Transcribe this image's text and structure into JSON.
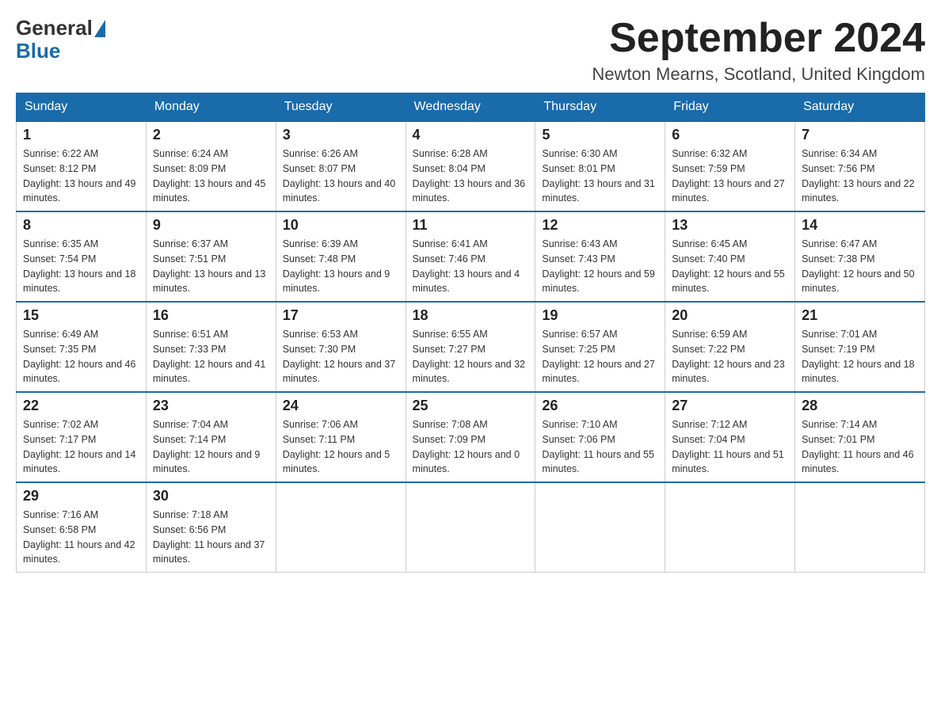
{
  "header": {
    "logo_general": "General",
    "logo_blue": "Blue",
    "month_title": "September 2024",
    "location": "Newton Mearns, Scotland, United Kingdom"
  },
  "weekdays": [
    "Sunday",
    "Monday",
    "Tuesday",
    "Wednesday",
    "Thursday",
    "Friday",
    "Saturday"
  ],
  "weeks": [
    [
      {
        "day": "1",
        "sunrise": "6:22 AM",
        "sunset": "8:12 PM",
        "daylight": "13 hours and 49 minutes."
      },
      {
        "day": "2",
        "sunrise": "6:24 AM",
        "sunset": "8:09 PM",
        "daylight": "13 hours and 45 minutes."
      },
      {
        "day": "3",
        "sunrise": "6:26 AM",
        "sunset": "8:07 PM",
        "daylight": "13 hours and 40 minutes."
      },
      {
        "day": "4",
        "sunrise": "6:28 AM",
        "sunset": "8:04 PM",
        "daylight": "13 hours and 36 minutes."
      },
      {
        "day": "5",
        "sunrise": "6:30 AM",
        "sunset": "8:01 PM",
        "daylight": "13 hours and 31 minutes."
      },
      {
        "day": "6",
        "sunrise": "6:32 AM",
        "sunset": "7:59 PM",
        "daylight": "13 hours and 27 minutes."
      },
      {
        "day": "7",
        "sunrise": "6:34 AM",
        "sunset": "7:56 PM",
        "daylight": "13 hours and 22 minutes."
      }
    ],
    [
      {
        "day": "8",
        "sunrise": "6:35 AM",
        "sunset": "7:54 PM",
        "daylight": "13 hours and 18 minutes."
      },
      {
        "day": "9",
        "sunrise": "6:37 AM",
        "sunset": "7:51 PM",
        "daylight": "13 hours and 13 minutes."
      },
      {
        "day": "10",
        "sunrise": "6:39 AM",
        "sunset": "7:48 PM",
        "daylight": "13 hours and 9 minutes."
      },
      {
        "day": "11",
        "sunrise": "6:41 AM",
        "sunset": "7:46 PM",
        "daylight": "13 hours and 4 minutes."
      },
      {
        "day": "12",
        "sunrise": "6:43 AM",
        "sunset": "7:43 PM",
        "daylight": "12 hours and 59 minutes."
      },
      {
        "day": "13",
        "sunrise": "6:45 AM",
        "sunset": "7:40 PM",
        "daylight": "12 hours and 55 minutes."
      },
      {
        "day": "14",
        "sunrise": "6:47 AM",
        "sunset": "7:38 PM",
        "daylight": "12 hours and 50 minutes."
      }
    ],
    [
      {
        "day": "15",
        "sunrise": "6:49 AM",
        "sunset": "7:35 PM",
        "daylight": "12 hours and 46 minutes."
      },
      {
        "day": "16",
        "sunrise": "6:51 AM",
        "sunset": "7:33 PM",
        "daylight": "12 hours and 41 minutes."
      },
      {
        "day": "17",
        "sunrise": "6:53 AM",
        "sunset": "7:30 PM",
        "daylight": "12 hours and 37 minutes."
      },
      {
        "day": "18",
        "sunrise": "6:55 AM",
        "sunset": "7:27 PM",
        "daylight": "12 hours and 32 minutes."
      },
      {
        "day": "19",
        "sunrise": "6:57 AM",
        "sunset": "7:25 PM",
        "daylight": "12 hours and 27 minutes."
      },
      {
        "day": "20",
        "sunrise": "6:59 AM",
        "sunset": "7:22 PM",
        "daylight": "12 hours and 23 minutes."
      },
      {
        "day": "21",
        "sunrise": "7:01 AM",
        "sunset": "7:19 PM",
        "daylight": "12 hours and 18 minutes."
      }
    ],
    [
      {
        "day": "22",
        "sunrise": "7:02 AM",
        "sunset": "7:17 PM",
        "daylight": "12 hours and 14 minutes."
      },
      {
        "day": "23",
        "sunrise": "7:04 AM",
        "sunset": "7:14 PM",
        "daylight": "12 hours and 9 minutes."
      },
      {
        "day": "24",
        "sunrise": "7:06 AM",
        "sunset": "7:11 PM",
        "daylight": "12 hours and 5 minutes."
      },
      {
        "day": "25",
        "sunrise": "7:08 AM",
        "sunset": "7:09 PM",
        "daylight": "12 hours and 0 minutes."
      },
      {
        "day": "26",
        "sunrise": "7:10 AM",
        "sunset": "7:06 PM",
        "daylight": "11 hours and 55 minutes."
      },
      {
        "day": "27",
        "sunrise": "7:12 AM",
        "sunset": "7:04 PM",
        "daylight": "11 hours and 51 minutes."
      },
      {
        "day": "28",
        "sunrise": "7:14 AM",
        "sunset": "7:01 PM",
        "daylight": "11 hours and 46 minutes."
      }
    ],
    [
      {
        "day": "29",
        "sunrise": "7:16 AM",
        "sunset": "6:58 PM",
        "daylight": "11 hours and 42 minutes."
      },
      {
        "day": "30",
        "sunrise": "7:18 AM",
        "sunset": "6:56 PM",
        "daylight": "11 hours and 37 minutes."
      },
      null,
      null,
      null,
      null,
      null
    ]
  ]
}
